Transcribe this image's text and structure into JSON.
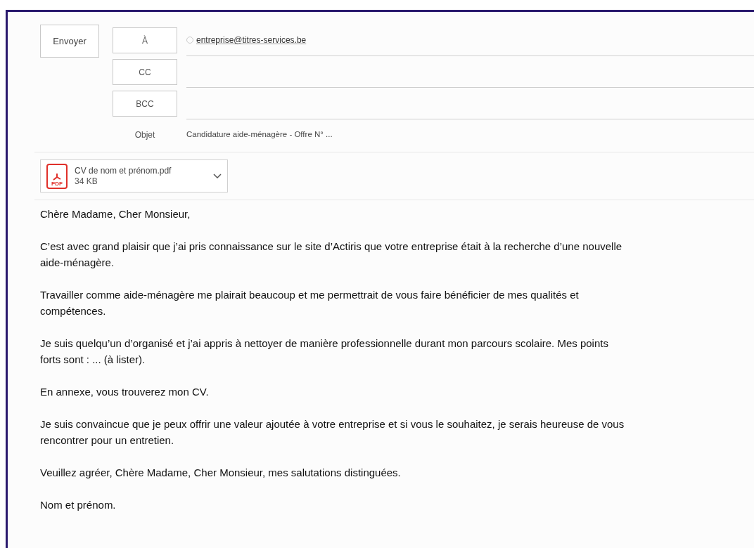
{
  "send_button": "Envoyer",
  "recipients": [
    {
      "label": "À",
      "value": "entreprise@titres-services.be"
    },
    {
      "label": "CC"
    },
    {
      "label": "BCC"
    }
  ],
  "subject": {
    "label": "Objet",
    "value": "Candidature aide-ménagère - Offre N° ..."
  },
  "attachment": {
    "name": "CV de nom et prénom.pdf",
    "size": "34 KB",
    "type_label": "PDF"
  },
  "body": [
    "Chère Madame, Cher Monsieur,",
    "C’est avec grand plaisir que j’ai pris connaissance sur le site d’Actiris que votre entreprise était à la recherche d’une nouvelle aide-ménagère.",
    "Travailler comme aide-ménagère me plairait beaucoup et me permettrait de vous faire bénéficier de mes qualités et compétences.",
    "Je suis quelqu’un d’organisé et j’ai appris à nettoyer de manière professionnelle durant mon parcours scolaire. Mes points forts sont : ... (à lister).",
    "En annexe, vous trouverez mon CV.",
    "Je suis convaincue que je peux offrir une valeur ajoutée à votre entreprise et si vous le souhaitez, je serais heureuse de vous rencontrer pour un entretien.",
    "Veuillez agréer, Chère Madame, Cher Monsieur, mes salutations distinguées.",
    "Nom et prénom."
  ]
}
